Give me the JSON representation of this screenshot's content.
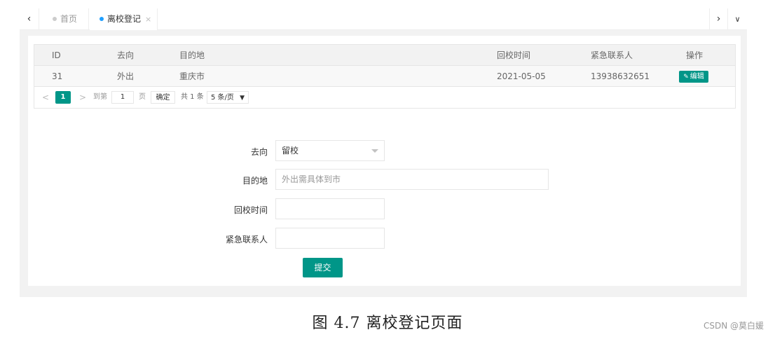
{
  "tabs": {
    "home_label": "首页",
    "active_label": "离校登记",
    "close_glyph": "×",
    "nav_left": "‹",
    "nav_right": "›",
    "nav_menu": "∨"
  },
  "table": {
    "headers": [
      "ID",
      "去向",
      "目的地",
      "回校时间",
      "紧急联系人",
      "操作"
    ],
    "rows": [
      {
        "id": "31",
        "direction": "外出",
        "destination": "重庆市",
        "return_date": "2021-05-05",
        "emergency_contact": "13938632651",
        "action_label": "编辑"
      }
    ]
  },
  "pager": {
    "prev": "<",
    "current_page": "1",
    "next": ">",
    "goto_label": "到第",
    "goto_value": "1",
    "page_unit": "页",
    "confirm_label": "确定",
    "total_label": "共 1 条",
    "page_size_label": "5 条/页"
  },
  "form": {
    "direction_label": "去向",
    "direction_value": "留校",
    "destination_label": "目的地",
    "destination_placeholder": "外出需具体到市",
    "return_time_label": "回校时间",
    "emergency_contact_label": "紧急联系人",
    "submit_label": "提交"
  },
  "caption": "图 4.7 离校登记页面",
  "watermark": "CSDN @莫白媛",
  "colors": {
    "primary": "#009688",
    "tab_dot_active": "#1e9fff"
  }
}
